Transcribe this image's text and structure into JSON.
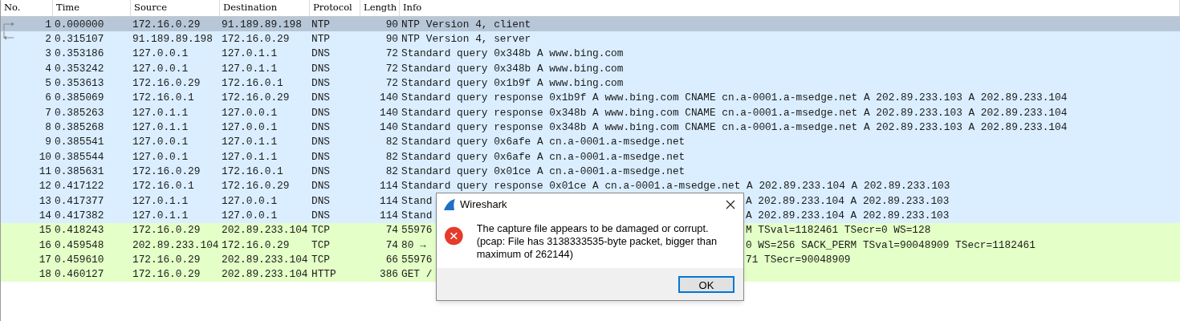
{
  "packet_list": {
    "columns": [
      "No.",
      "Time",
      "Source",
      "Destination",
      "Protocol",
      "Length",
      "Info"
    ],
    "rows": [
      {
        "no": "1",
        "time": "0.000000",
        "source": "172.16.0.29",
        "destination": "91.189.89.198",
        "protocol": "NTP",
        "length": "90",
        "info": "NTP Version 4, client",
        "selected": true,
        "request_marker": true
      },
      {
        "no": "2",
        "time": "0.315107",
        "source": "91.189.89.198",
        "destination": "172.16.0.29",
        "protocol": "NTP",
        "length": "90",
        "info": "NTP Version 4, server",
        "color": "#daeeff",
        "selected": false,
        "response_marker": true
      },
      {
        "no": "3",
        "time": "0.353186",
        "source": "127.0.0.1",
        "destination": "127.0.1.1",
        "protocol": "DNS",
        "length": "72",
        "info": "Standard query 0x348b A www.bing.com",
        "color": "#daeeff",
        "selected": false
      },
      {
        "no": "4",
        "time": "0.353242",
        "source": "127.0.0.1",
        "destination": "127.0.1.1",
        "protocol": "DNS",
        "length": "72",
        "info": "Standard query 0x348b A www.bing.com",
        "color": "#daeeff",
        "selected": false
      },
      {
        "no": "5",
        "time": "0.353613",
        "source": "172.16.0.29",
        "destination": "172.16.0.1",
        "protocol": "DNS",
        "length": "72",
        "info": "Standard query 0x1b9f A www.bing.com",
        "color": "#daeeff",
        "selected": false
      },
      {
        "no": "6",
        "time": "0.385069",
        "source": "172.16.0.1",
        "destination": "172.16.0.29",
        "protocol": "DNS",
        "length": "140",
        "info": "Standard query response 0x1b9f A www.bing.com CNAME cn.a-0001.a-msedge.net A 202.89.233.103 A 202.89.233.104",
        "color": "#daeeff",
        "selected": false
      },
      {
        "no": "7",
        "time": "0.385263",
        "source": "127.0.1.1",
        "destination": "127.0.0.1",
        "protocol": "DNS",
        "length": "140",
        "info": "Standard query response 0x348b A www.bing.com CNAME cn.a-0001.a-msedge.net A 202.89.233.103 A 202.89.233.104",
        "color": "#daeeff",
        "selected": false
      },
      {
        "no": "8",
        "time": "0.385268",
        "source": "127.0.1.1",
        "destination": "127.0.0.1",
        "protocol": "DNS",
        "length": "140",
        "info": "Standard query response 0x348b A www.bing.com CNAME cn.a-0001.a-msedge.net A 202.89.233.103 A 202.89.233.104",
        "color": "#daeeff",
        "selected": false
      },
      {
        "no": "9",
        "time": "0.385541",
        "source": "127.0.0.1",
        "destination": "127.0.1.1",
        "protocol": "DNS",
        "length": "82",
        "info": "Standard query 0x6afe A cn.a-0001.a-msedge.net",
        "color": "#daeeff",
        "selected": false
      },
      {
        "no": "10",
        "time": "0.385544",
        "source": "127.0.0.1",
        "destination": "127.0.1.1",
        "protocol": "DNS",
        "length": "82",
        "info": "Standard query 0x6afe A cn.a-0001.a-msedge.net",
        "color": "#daeeff",
        "selected": false
      },
      {
        "no": "11",
        "time": "0.385631",
        "source": "172.16.0.29",
        "destination": "172.16.0.1",
        "protocol": "DNS",
        "length": "82",
        "info": "Standard query 0x01ce A cn.a-0001.a-msedge.net",
        "color": "#daeeff",
        "selected": false
      },
      {
        "no": "12",
        "time": "0.417122",
        "source": "172.16.0.1",
        "destination": "172.16.0.29",
        "protocol": "DNS",
        "length": "114",
        "info": "Standard query response 0x01ce A cn.a-0001.a-msedge.net A 202.89.233.104 A 202.89.233.103",
        "color": "#daeeff",
        "selected": false
      },
      {
        "no": "13",
        "time": "0.417377",
        "source": "127.0.1.1",
        "destination": "127.0.0.1",
        "protocol": "DNS",
        "length": "114",
        "info": "Stand",
        "info_tail": "A 202.89.233.104 A 202.89.233.103",
        "color": "#daeeff",
        "selected": false
      },
      {
        "no": "14",
        "time": "0.417382",
        "source": "127.0.1.1",
        "destination": "127.0.0.1",
        "protocol": "DNS",
        "length": "114",
        "info": "Stand",
        "info_tail": "A 202.89.233.104 A 202.89.233.103",
        "color": "#daeeff",
        "selected": false
      },
      {
        "no": "15",
        "time": "0.418243",
        "source": "172.16.0.29",
        "destination": "202.89.233.104",
        "protocol": "TCP",
        "length": "74",
        "info": "55976",
        "info_tail": "M TSval=1182461 TSecr=0 WS=128",
        "color": "#e4ffc7",
        "selected": false
      },
      {
        "no": "16",
        "time": "0.459548",
        "source": "202.89.233.104",
        "destination": "172.16.0.29",
        "protocol": "TCP",
        "length": "74",
        "info": "80 →",
        "info_tail": "0 WS=256 SACK_PERM TSval=90048909 TSecr=1182461",
        "color": "#e4ffc7",
        "selected": false
      },
      {
        "no": "17",
        "time": "0.459610",
        "source": "172.16.0.29",
        "destination": "202.89.233.104",
        "protocol": "TCP",
        "length": "66",
        "info": "55976",
        "info_tail": "71 TSecr=90048909",
        "color": "#e4ffc7",
        "selected": false
      },
      {
        "no": "18",
        "time": "0.460127",
        "source": "172.16.0.29",
        "destination": "202.89.233.104",
        "protocol": "HTTP",
        "length": "386",
        "info": "GET /",
        "color": "#e4ffc7",
        "selected": false
      }
    ]
  },
  "dialog": {
    "title": "Wireshark",
    "message": "The capture file appears to be damaged or corrupt.",
    "detail": "(pcap: File has 3138333535-byte packet, bigger than maximum of 262144)",
    "buttons": [
      "OK"
    ]
  }
}
